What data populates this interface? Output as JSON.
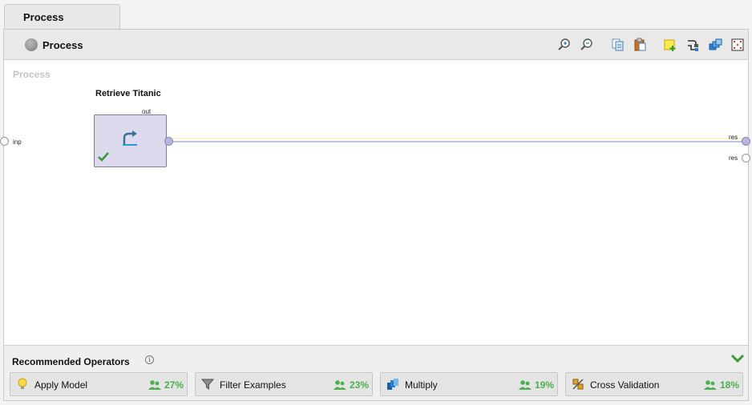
{
  "tabs": [
    {
      "label": "Process"
    }
  ],
  "header": {
    "title": "Process"
  },
  "toolbar": {
    "icons": [
      "zoom-in-icon",
      "zoom-out-icon",
      "copy-icon",
      "paste-icon",
      "add-note-icon",
      "auto-wire-icon",
      "arrange-icon",
      "fit-view-icon"
    ]
  },
  "canvas": {
    "label": "Process",
    "input_port": "inp",
    "output_ports": [
      "res",
      "res"
    ]
  },
  "operator": {
    "name": "Retrieve Titanic",
    "output_port": "out",
    "status": "ok",
    "icon": "retrieve-arrow-icon"
  },
  "recommended": {
    "title": "Recommended Operators",
    "items": [
      {
        "name": "Apply Model",
        "percent": "27%",
        "icon": "lightbulb-icon"
      },
      {
        "name": "Filter Examples",
        "percent": "23%",
        "icon": "funnel-icon"
      },
      {
        "name": "Multiply",
        "percent": "19%",
        "icon": "multiply-icon"
      },
      {
        "name": "Cross Validation",
        "percent": "18%",
        "icon": "cross-validation-icon"
      }
    ]
  },
  "colors": {
    "accent_green": "#4caf50",
    "operator_fill": "#dcdaec",
    "connection": "#9b9bd0"
  }
}
